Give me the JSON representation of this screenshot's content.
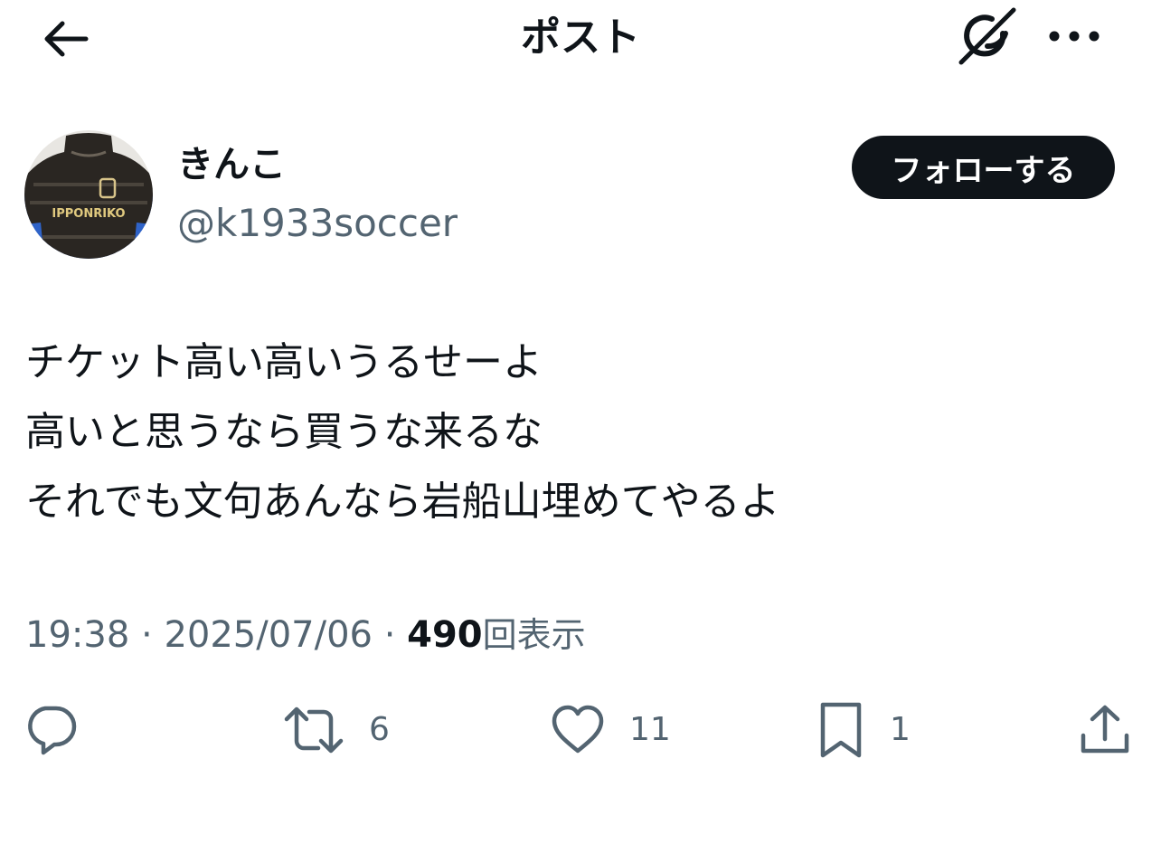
{
  "header": {
    "title": "ポスト",
    "back_icon": "arrow-left-icon",
    "grok_icon": "grok-icon",
    "more_icon": "more-horizontal-icon"
  },
  "author": {
    "display_name": "きんこ",
    "handle": "@k1933soccer",
    "avatar_text": "IPPONRIKO",
    "follow_label": "フォローする"
  },
  "post": {
    "lines": [
      "チケット高い高いうるせーよ",
      "高いと思うなら買うな来るな",
      "それでも文句あんなら岩船山埋めてやるよ"
    ],
    "time": "19:38",
    "separator": "·",
    "date": "2025/07/06",
    "views_count": "490",
    "views_label": "回表示"
  },
  "actions": {
    "reply": {
      "icon": "reply-icon",
      "count": ""
    },
    "repost": {
      "icon": "repost-icon",
      "count": "6"
    },
    "like": {
      "icon": "heart-icon",
      "count": "11"
    },
    "bookmark": {
      "icon": "bookmark-icon",
      "count": "1"
    },
    "share": {
      "icon": "share-icon",
      "count": ""
    }
  },
  "colors": {
    "text_primary": "#0f1419",
    "text_secondary": "#536471",
    "follow_bg": "#0f1419",
    "follow_text": "#ffffff"
  }
}
